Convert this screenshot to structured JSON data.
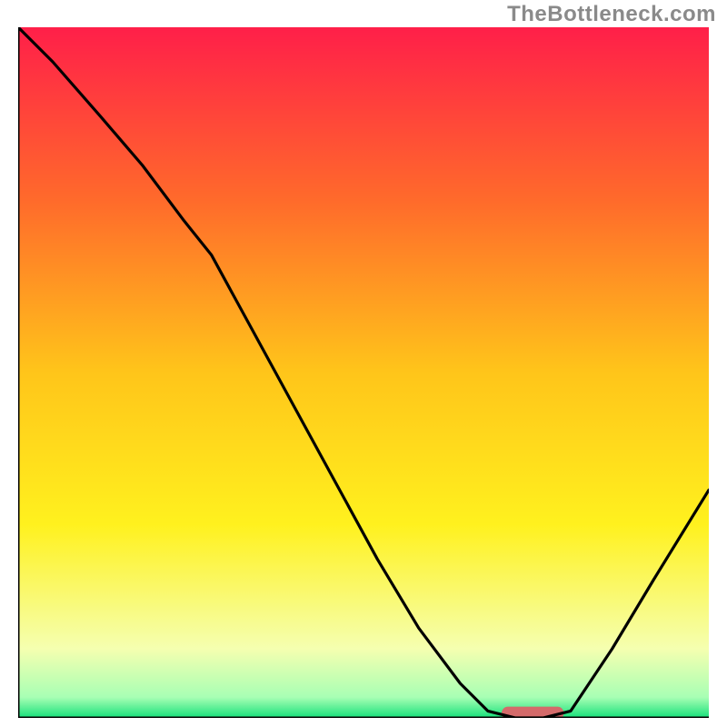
{
  "watermark": "TheBottleneck.com",
  "chart_data": {
    "type": "line",
    "title": "",
    "xlabel": "",
    "ylabel": "",
    "xlim": [
      0,
      100
    ],
    "ylim": [
      0,
      100
    ],
    "grid": false,
    "legend": false,
    "gradient_stops": [
      {
        "offset": 0.0,
        "color": "#ff1f49"
      },
      {
        "offset": 0.25,
        "color": "#ff6a2b"
      },
      {
        "offset": 0.5,
        "color": "#ffc51a"
      },
      {
        "offset": 0.72,
        "color": "#fff11e"
      },
      {
        "offset": 0.9,
        "color": "#f5ffb0"
      },
      {
        "offset": 0.97,
        "color": "#a8ffb4"
      },
      {
        "offset": 1.0,
        "color": "#16e07a"
      }
    ],
    "series": [
      {
        "name": "curve",
        "x": [
          0,
          5,
          12,
          18,
          24,
          28,
          34,
          40,
          46,
          52,
          58,
          64,
          68,
          72,
          76,
          80,
          86,
          92,
          100
        ],
        "values": [
          100,
          95,
          87,
          80,
          72,
          67,
          56,
          45,
          34,
          23,
          13,
          5,
          1,
          0,
          0,
          1,
          10,
          20,
          33
        ]
      }
    ],
    "marker": {
      "x_start": 70,
      "x_end": 79,
      "y": 0.7,
      "color": "#d46a6a"
    },
    "axes": {
      "frame_color": "#000000",
      "frame_width": 3
    }
  }
}
